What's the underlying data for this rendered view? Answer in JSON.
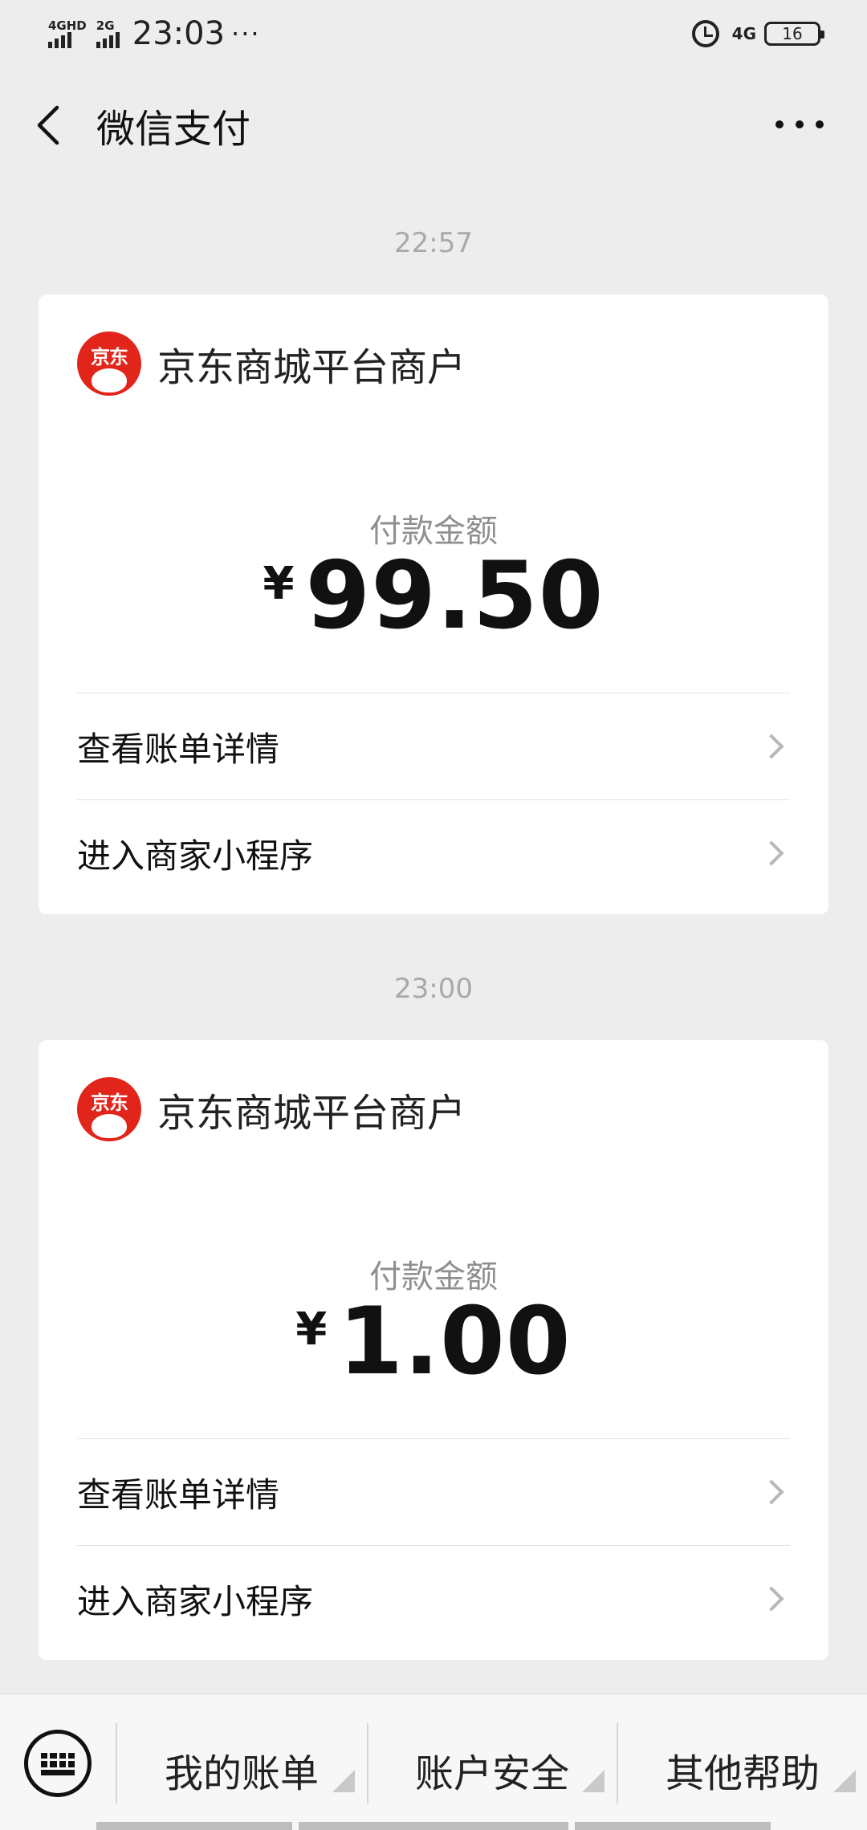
{
  "status_bar": {
    "sim1_label": "4GHD",
    "sim2_label": "2G",
    "time": "23:03",
    "dots": "···",
    "network": "4G",
    "battery": "16"
  },
  "header": {
    "title": "微信支付"
  },
  "messages": [
    {
      "time": "22:57",
      "merchant_logo_text": "京东",
      "merchant_name": "京东商城平台商户",
      "amount_label": "付款金额",
      "currency": "¥",
      "amount": "99.50",
      "actions": [
        "查看账单详情",
        "进入商家小程序"
      ]
    },
    {
      "time": "23:00",
      "merchant_logo_text": "京东",
      "merchant_name": "京东商城平台商户",
      "amount_label": "付款金额",
      "currency": "¥",
      "amount": "1.00",
      "actions": [
        "查看账单详情",
        "进入商家小程序"
      ]
    }
  ],
  "bottom_menu": {
    "items": [
      "我的账单",
      "账户安全",
      "其他帮助"
    ]
  },
  "colors": {
    "background": "#ededed",
    "card": "#ffffff",
    "jd_red": "#e1251b",
    "muted_text": "#8f8f8f"
  }
}
